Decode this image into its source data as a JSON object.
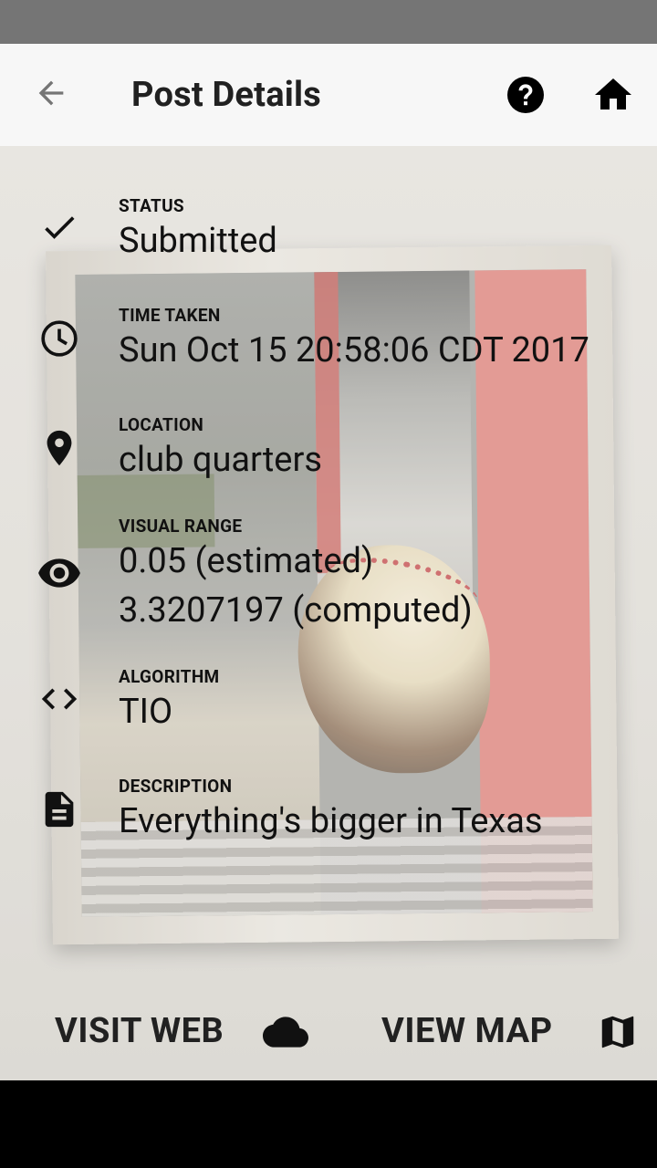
{
  "appbar": {
    "title": "Post Details",
    "icons": {
      "back": "arrow-back-icon",
      "help": "help-icon",
      "home": "home-icon"
    }
  },
  "details": {
    "status": {
      "label": "STATUS",
      "value": "Submitted",
      "icon": "check-icon"
    },
    "time_taken": {
      "label": "TIME TAKEN",
      "value": "Sun Oct 15 20:58:06 CDT 2017",
      "icon": "clock-icon"
    },
    "location": {
      "label": "LOCATION",
      "value": "club quarters",
      "icon": "location-pin-icon"
    },
    "visual_range": {
      "label": "VISUAL RANGE",
      "estimated": "0.05 (estimated)",
      "computed": "3.3207197 (computed)",
      "icon": "eye-icon"
    },
    "algorithm": {
      "label": "ALGORITHM",
      "value": "TIO",
      "icon": "code-icon"
    },
    "description": {
      "label": "DESCRIPTION",
      "value": "Everything's bigger in Texas",
      "icon": "document-icon"
    }
  },
  "actions": {
    "visit_web": {
      "label": "VISIT WEB",
      "icon": "cloud-icon"
    },
    "view_map": {
      "label": "VIEW MAP",
      "icon": "map-icon"
    }
  },
  "colors": {
    "appbar_bg": "#f7f7f7",
    "status_bar": "#757575",
    "text": "#111111"
  }
}
